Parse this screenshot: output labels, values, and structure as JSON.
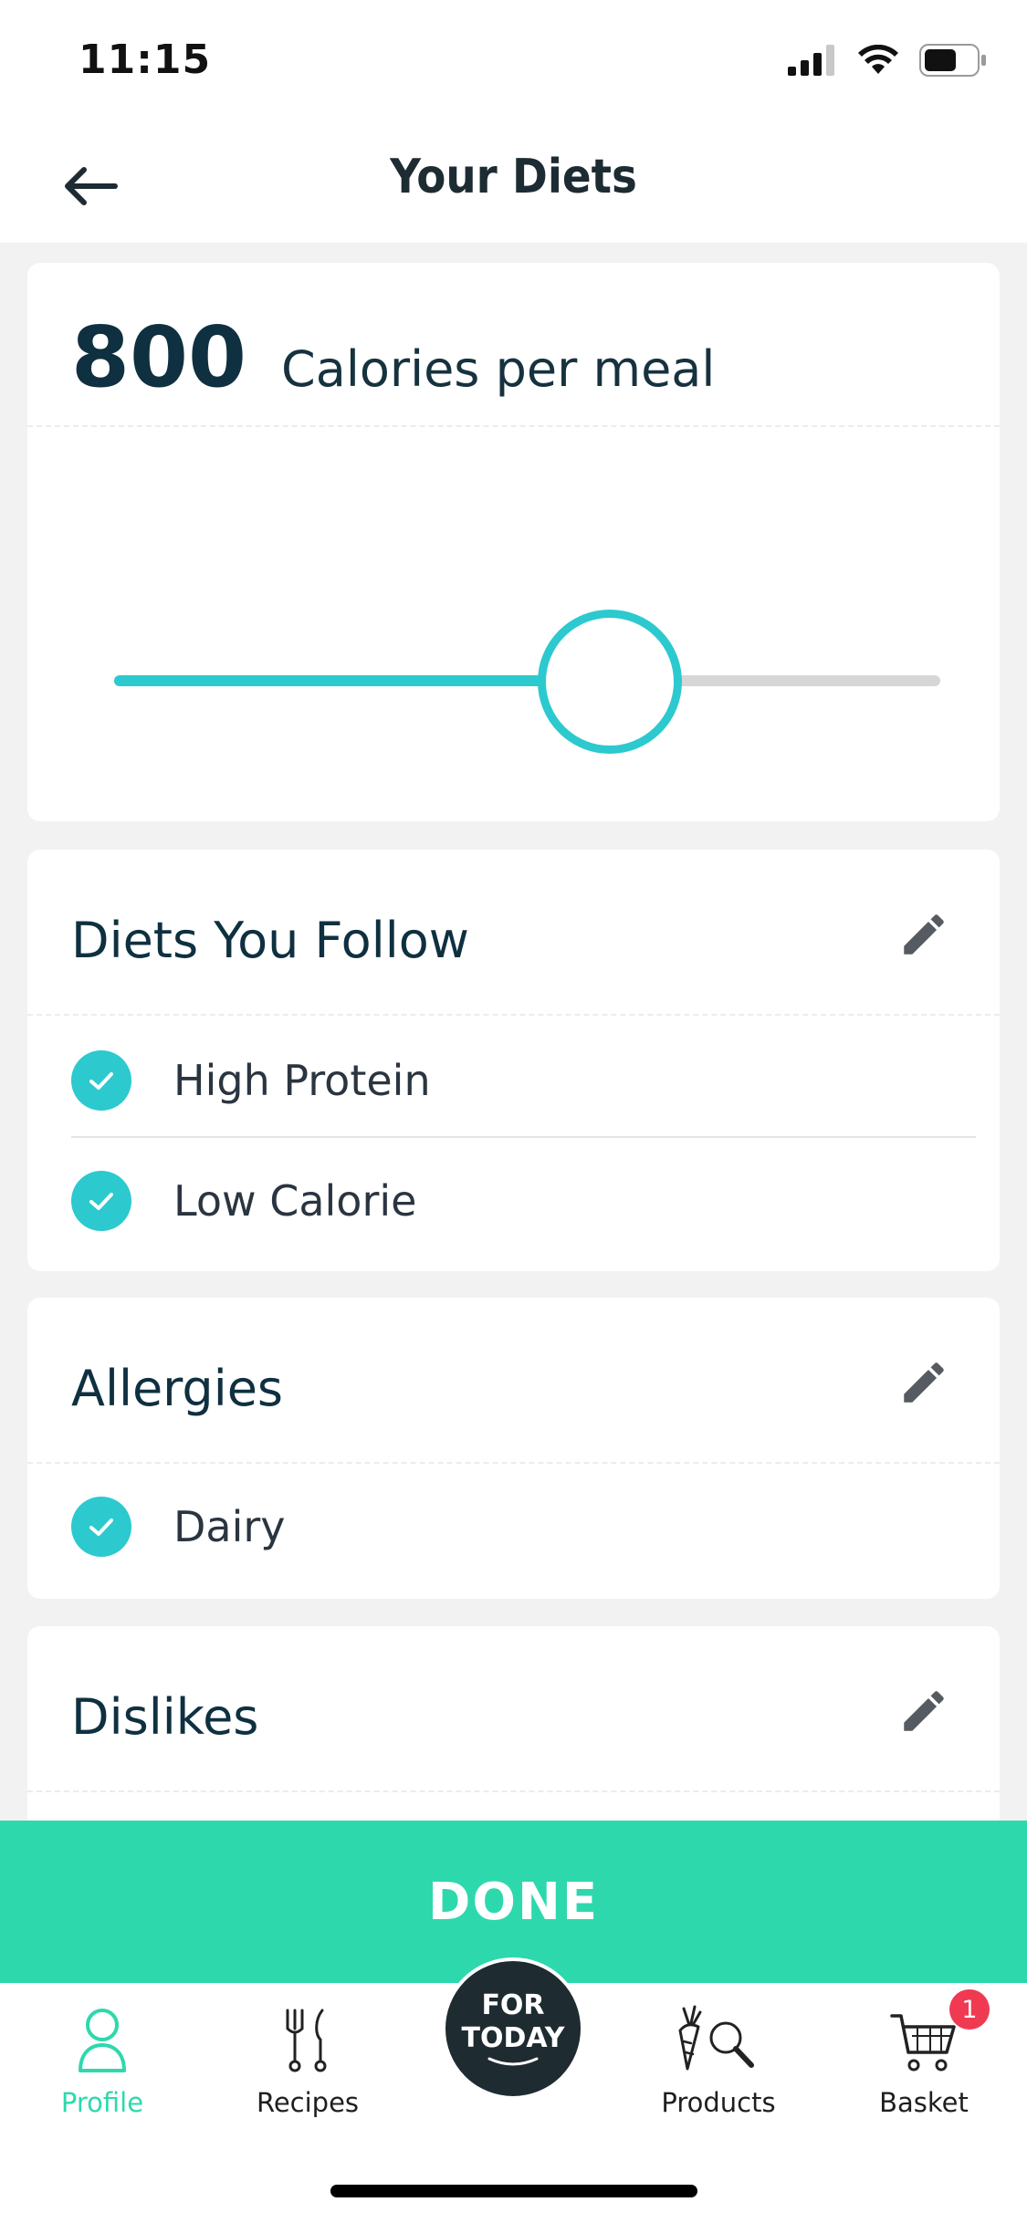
{
  "status_bar": {
    "time": "11:15"
  },
  "header": {
    "title": "Your Diets"
  },
  "calories": {
    "value": "800",
    "label": "Calories per meal",
    "slider_fraction": 0.6
  },
  "diets": {
    "title": "Diets You Follow",
    "items": [
      "High Protein",
      "Low Calorie"
    ]
  },
  "allergies": {
    "title": "Allergies",
    "items": [
      "Dairy"
    ]
  },
  "dislikes": {
    "title": "Dislikes"
  },
  "done": {
    "label": "DONE"
  },
  "tabs": {
    "profile": "Profile",
    "recipes": "Recipes",
    "center": [
      "FOR",
      "TODAY"
    ],
    "products": "Products",
    "basket": "Basket",
    "basket_count": "1"
  },
  "colors": {
    "accent": "#2cc9cf",
    "done_green": "#2ed8ad",
    "badge_red": "#ef3a52"
  }
}
